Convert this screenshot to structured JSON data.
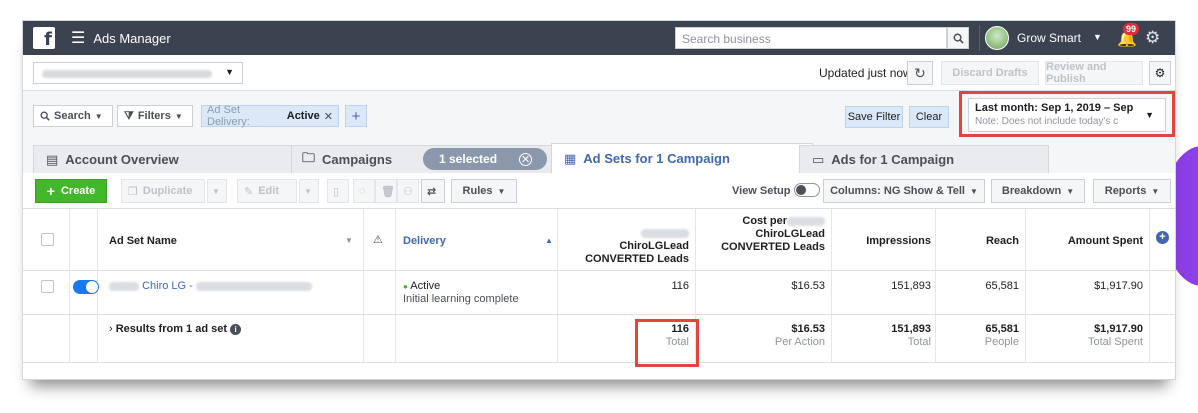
{
  "topbar": {
    "app_name": "Ads Manager",
    "search_placeholder": "Search business",
    "account_name": "Grow Smart",
    "notification_count": "99"
  },
  "toolbar_top": {
    "updated_text": "Updated just now",
    "discard_label": "Discard Drafts",
    "review_label": "Review and Publish"
  },
  "filters": {
    "search_label": "Search",
    "filters_label": "Filters",
    "pill_key": "Ad Set Delivery:",
    "pill_value": "Active",
    "save_filter_label": "Save Filter",
    "clear_label": "Clear",
    "date_main": "Last month: Sep 1, 2019 – Sep",
    "date_note": "Note: Does not include today's c"
  },
  "tabs": {
    "account_overview": "Account Overview",
    "campaigns": "Campaigns",
    "selected_pill": "1 selected",
    "ad_sets": "Ad Sets for 1 Campaign",
    "ads": "Ads for 1 Campaign"
  },
  "actions": {
    "create": "Create",
    "duplicate": "Duplicate",
    "edit": "Edit",
    "rules": "Rules",
    "view_setup": "View Setup",
    "columns": "Columns: NG Show & Tell",
    "breakdown": "Breakdown",
    "reports": "Reports"
  },
  "table": {
    "headers": {
      "name": "Ad Set Name",
      "delivery": "Delivery",
      "leads_line1": "ChiroLGLead",
      "leads_line2": "CONVERTED Leads",
      "cost_line1": "Cost per",
      "cost_line2": "ChiroLGLead",
      "cost_line3": "CONVERTED Leads",
      "impressions": "Impressions",
      "reach": "Reach",
      "amount": "Amount Spent"
    },
    "row": {
      "name": "Chiro LG -",
      "delivery_status": "Active",
      "delivery_sub": "Initial learning complete",
      "leads": "116",
      "cost": "$16.53",
      "impressions": "151,893",
      "reach": "65,581",
      "amount": "$1,917.90"
    },
    "summary": {
      "label": "Results from 1 ad set",
      "leads": "116",
      "leads_sub": "Total",
      "cost": "$16.53",
      "cost_sub": "Per Action",
      "impressions": "151,893",
      "impressions_sub": "Total",
      "reach": "65,581",
      "reach_sub": "People",
      "amount": "$1,917.90",
      "amount_sub": "Total Spent"
    }
  },
  "colors": {
    "topbar": "#3b4250",
    "accent": "#4267b2",
    "create_green": "#42b72a",
    "highlight_red": "#e0463e",
    "decor_purple": "#8c3fe6"
  }
}
